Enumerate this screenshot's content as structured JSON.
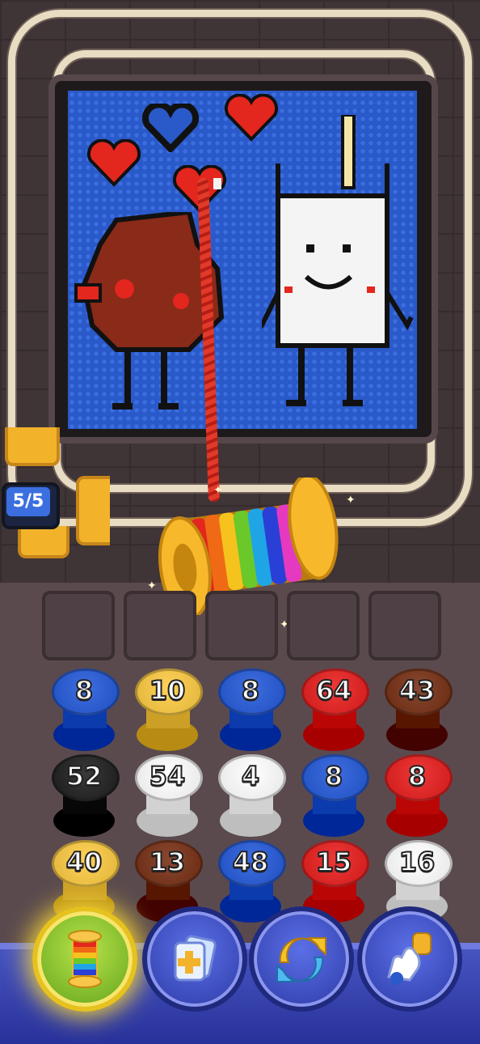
{
  "progress": {
    "label": "5/5",
    "current": 5,
    "total": 5
  },
  "tray_slots": 5,
  "spool_grid": [
    {
      "value": "8",
      "color": "#1f4fc0"
    },
    {
      "value": "10",
      "color": "#e0b43a"
    },
    {
      "value": "8",
      "color": "#1f4fc0"
    },
    {
      "value": "64",
      "color": "#cf1a1a"
    },
    {
      "value": "43",
      "color": "#6a2a12"
    },
    {
      "value": "52",
      "color": "#1b1b1b"
    },
    {
      "value": "54",
      "color": "#e6e6e6"
    },
    {
      "value": "4",
      "color": "#e6e6e6"
    },
    {
      "value": "8",
      "color": "#1f4fc0"
    },
    {
      "value": "8",
      "color": "#cf1a1a"
    },
    {
      "value": "40",
      "color": "#e0b43a"
    },
    {
      "value": "13",
      "color": "#6a2a12"
    },
    {
      "value": "48",
      "color": "#1f4fc0"
    },
    {
      "value": "15",
      "color": "#cf1a1a"
    },
    {
      "value": "16",
      "color": "#e6e6e6"
    }
  ],
  "bottom_buttons": [
    {
      "name": "rainbow-spool-booster-button",
      "icon": "rainbow-spool-icon"
    },
    {
      "name": "add-slot-booster-button",
      "icon": "add-cards-icon"
    },
    {
      "name": "shuffle-booster-button",
      "icon": "shuffle-arrows-icon"
    },
    {
      "name": "pick-spool-booster-button",
      "icon": "hand-pick-icon"
    }
  ],
  "colors": {
    "canvas_blue": "#2a59c9",
    "track": "#e8dcc3",
    "gold": "#f2b32a"
  }
}
